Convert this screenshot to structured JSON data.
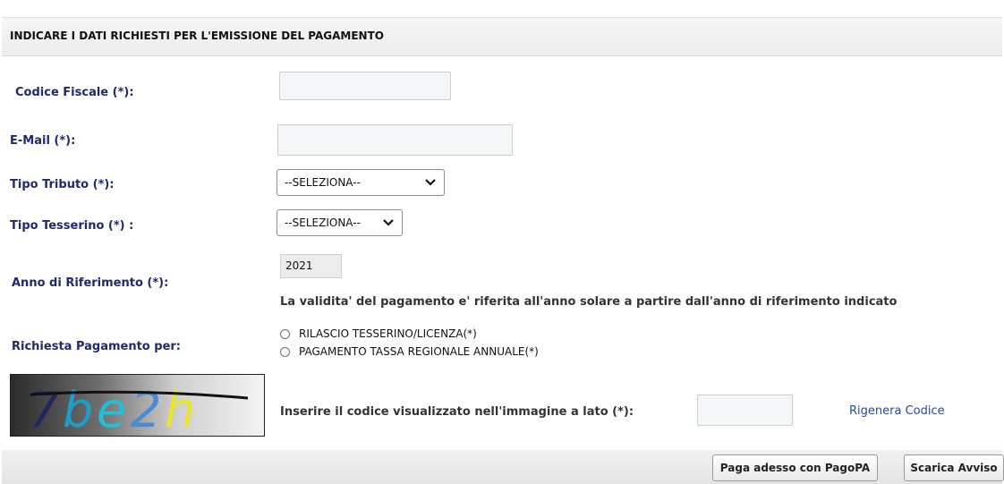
{
  "header": {
    "title": "INDICARE I DATI RICHIESTI PER L'EMISSIONE DEL PAGAMENTO"
  },
  "form": {
    "codice_fiscale": {
      "label": "Codice Fiscale (*):",
      "value": ""
    },
    "email": {
      "label": "E-Mail (*):",
      "value": ""
    },
    "tipo_tributo": {
      "label": "Tipo Tributo (*):",
      "selected": "--SELEZIONA--"
    },
    "tipo_tesserino": {
      "label": "Tipo Tesserino (*) :",
      "selected": "--SELEZIONA--"
    },
    "anno": {
      "label": "Anno di Riferimento (*):",
      "value": "2021",
      "note": "La validita' del pagamento e' riferita all'anno solare a partire dall'anno di riferimento indicato"
    },
    "richiesta": {
      "label": "Richiesta Pagamento per:",
      "options": [
        "RILASCIO TESSERINO/LICENZA(*)",
        "PAGAMENTO TASSA REGIONALE ANNUALE(*)"
      ]
    },
    "captcha": {
      "image_text": "7be2h",
      "label": "Inserire il codice visualizzato nell'immagine a lato (*):",
      "value": "",
      "regenerate": "Rigenera Codice"
    }
  },
  "buttons": {
    "pay": "Paga adesso con PagoPA",
    "download": "Scarica Avviso"
  },
  "icons": {
    "select_arrow": "chevron-down-icon",
    "radio": "radio-icon"
  },
  "colors": {
    "label": "#1f2a6e",
    "link": "#1f4aa8"
  }
}
